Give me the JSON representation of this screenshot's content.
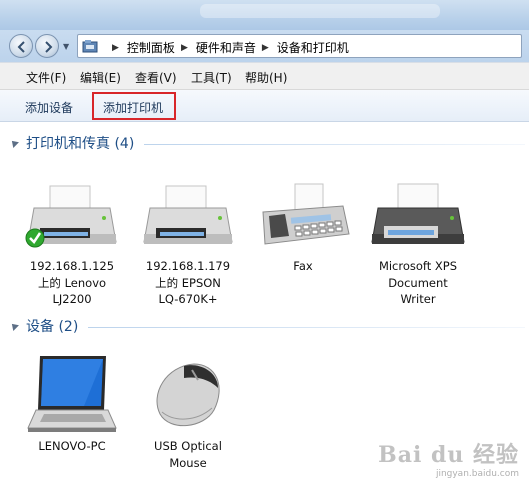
{
  "address": {
    "segments": [
      "控制面板",
      "硬件和声音",
      "设备和打印机"
    ]
  },
  "menu": {
    "file": "文件(F)",
    "edit": "编辑(E)",
    "view": "查看(V)",
    "tools": "工具(T)",
    "help": "帮助(H)"
  },
  "commands": {
    "add_device": "添加设备",
    "add_printer": "添加打印机"
  },
  "groups": {
    "printers": {
      "title": "打印机和传真 (4)",
      "items": [
        {
          "line1": "192.168.1.125",
          "line2": "上的 Lenovo",
          "line3": "LJ2200",
          "icon": "printer-icon",
          "default": true
        },
        {
          "line1": "192.168.1.179",
          "line2": "上的 EPSON",
          "line3": "LQ-670K+",
          "icon": "printer-icon"
        },
        {
          "line1": "Fax",
          "icon": "fax-icon"
        },
        {
          "line1": "Microsoft XPS",
          "line2": "Document",
          "line3": "Writer",
          "icon": "printer-icon"
        }
      ]
    },
    "devices": {
      "title": "设备 (2)",
      "items": [
        {
          "line1": "LENOVO-PC",
          "icon": "laptop-icon"
        },
        {
          "line1": "USB Optical",
          "line2": "Mouse",
          "icon": "mouse-icon"
        }
      ]
    }
  },
  "colors": {
    "highlight_border": "#d8262a",
    "group_title": "#1e4e86",
    "default_check": "#2fa82f"
  },
  "watermark": {
    "logo": "Bai du 经验",
    "url": "jingyan.baidu.com"
  }
}
